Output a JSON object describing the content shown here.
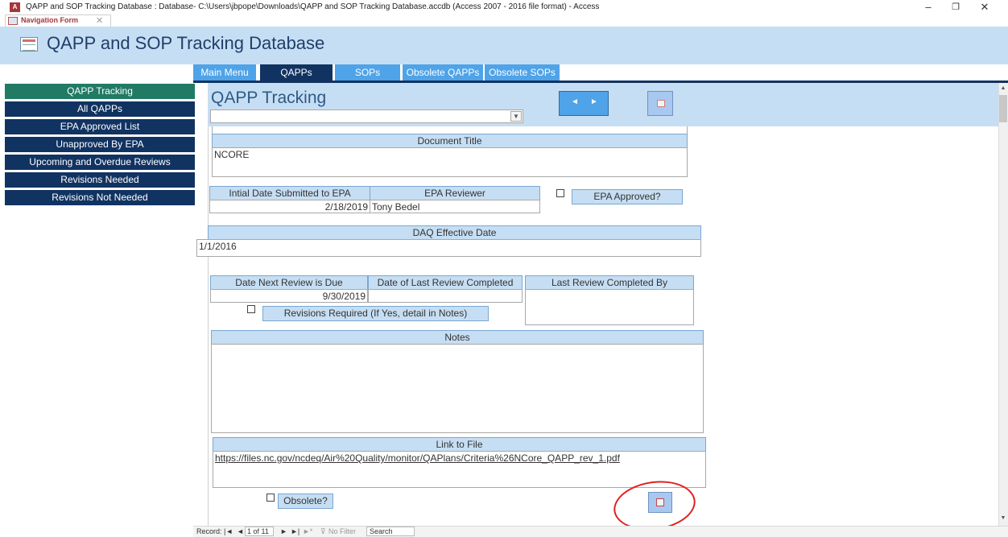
{
  "window": {
    "app_icon": "A",
    "title": "QAPP and SOP Tracking Database : Database- C:\\Users\\jbpope\\Downloads\\QAPP and SOP Tracking Database.accdb (Access 2007 - 2016 file format) - Access",
    "minimize": "–",
    "restore": "❐",
    "close": "✕"
  },
  "doc_tab": {
    "label": "Navigation Form",
    "close": "✕"
  },
  "header": {
    "title": "QAPP and SOP Tracking Database"
  },
  "top_tabs": [
    {
      "label": "Main Menu"
    },
    {
      "label": "QAPPs"
    },
    {
      "label": "SOPs"
    },
    {
      "label": "Obsolete QAPPs"
    },
    {
      "label": "Obsolete SOPs"
    }
  ],
  "nav": {
    "items": [
      {
        "label": "QAPP Tracking"
      },
      {
        "label": "All QAPPs"
      },
      {
        "label": "EPA Approved List"
      },
      {
        "label": "Unapproved By EPA"
      },
      {
        "label": "Upcoming and Overdue Reviews"
      },
      {
        "label": "Revisions Needed"
      },
      {
        "label": "Revisions Not Needed"
      }
    ]
  },
  "form": {
    "title": "QAPP Tracking",
    "prev": "◄",
    "next": "►",
    "document_title_label": "Document Title",
    "document_title_value": "NCORE",
    "initial_date_label": "Intial Date Submitted to EPA",
    "initial_date_value": "2/18/2019",
    "epa_reviewer_label": "EPA Reviewer",
    "epa_reviewer_value": "Tony Bedel",
    "epa_approved_label": "EPA Approved?",
    "daq_effective_label": "DAQ Effective Date",
    "daq_effective_value": "1/1/2016",
    "next_review_label": "Date Next Review is Due",
    "next_review_value": "9/30/2019",
    "last_review_label": "Date of Last Review Completed",
    "last_review_value": "",
    "last_review_by_label": "Last Review Completed By",
    "last_review_by_value": "",
    "revisions_label": "Revisions Required (If Yes, detail in Notes)",
    "notes_label": "Notes",
    "notes_value": "",
    "link_label": "Link to File",
    "link_value": "https://files.nc.gov/ncdeq/Air%20Quality/monitor/QAPlans/Criteria%26NCore_QAPP_rev_1.pdf",
    "obsolete_label": "Obsolete?"
  },
  "status": {
    "record_label": "Record:",
    "first": "|◄",
    "prev": "◄",
    "position": "1 of 11",
    "next": "►",
    "last": "►|",
    "new": "►*",
    "filter": "No Filter",
    "search": "Search"
  },
  "colors": {
    "nav_dark": "#113362",
    "nav_active": "#207a64",
    "tab_light": "#4fa3e8",
    "header_bg": "#c6def3",
    "annotation": "#e02020"
  }
}
